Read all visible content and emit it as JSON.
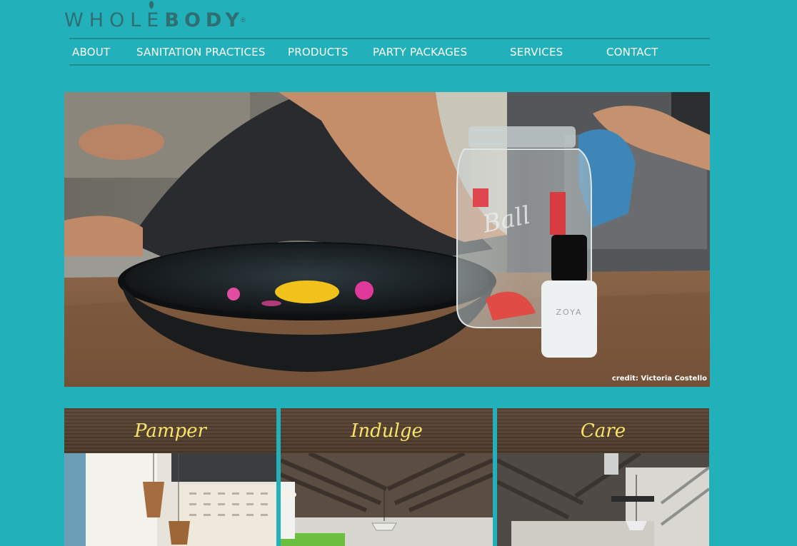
{
  "logo": {
    "whole": "WHOLE",
    "body": "BODY",
    "tm": "®"
  },
  "nav": {
    "items": [
      {
        "label": "ABOUT"
      },
      {
        "label": "SANITATION PRACTICES"
      },
      {
        "label": "PRODUCTS"
      },
      {
        "label": "PARTY PACKAGES"
      },
      {
        "label": "SERVICES"
      },
      {
        "label": "CONTACT"
      }
    ]
  },
  "hero": {
    "credit": "credit: Victoria Costello",
    "jar_text": "Ball",
    "bottle_text": "ZOYA"
  },
  "cards": [
    {
      "title": "Pamper"
    },
    {
      "title": "Indulge"
    },
    {
      "title": "Care"
    }
  ],
  "colors": {
    "background": "#22b0bb",
    "nav_line": "#1f8a92",
    "card_title": "#f7e26a",
    "logo": "#2f6f71"
  }
}
